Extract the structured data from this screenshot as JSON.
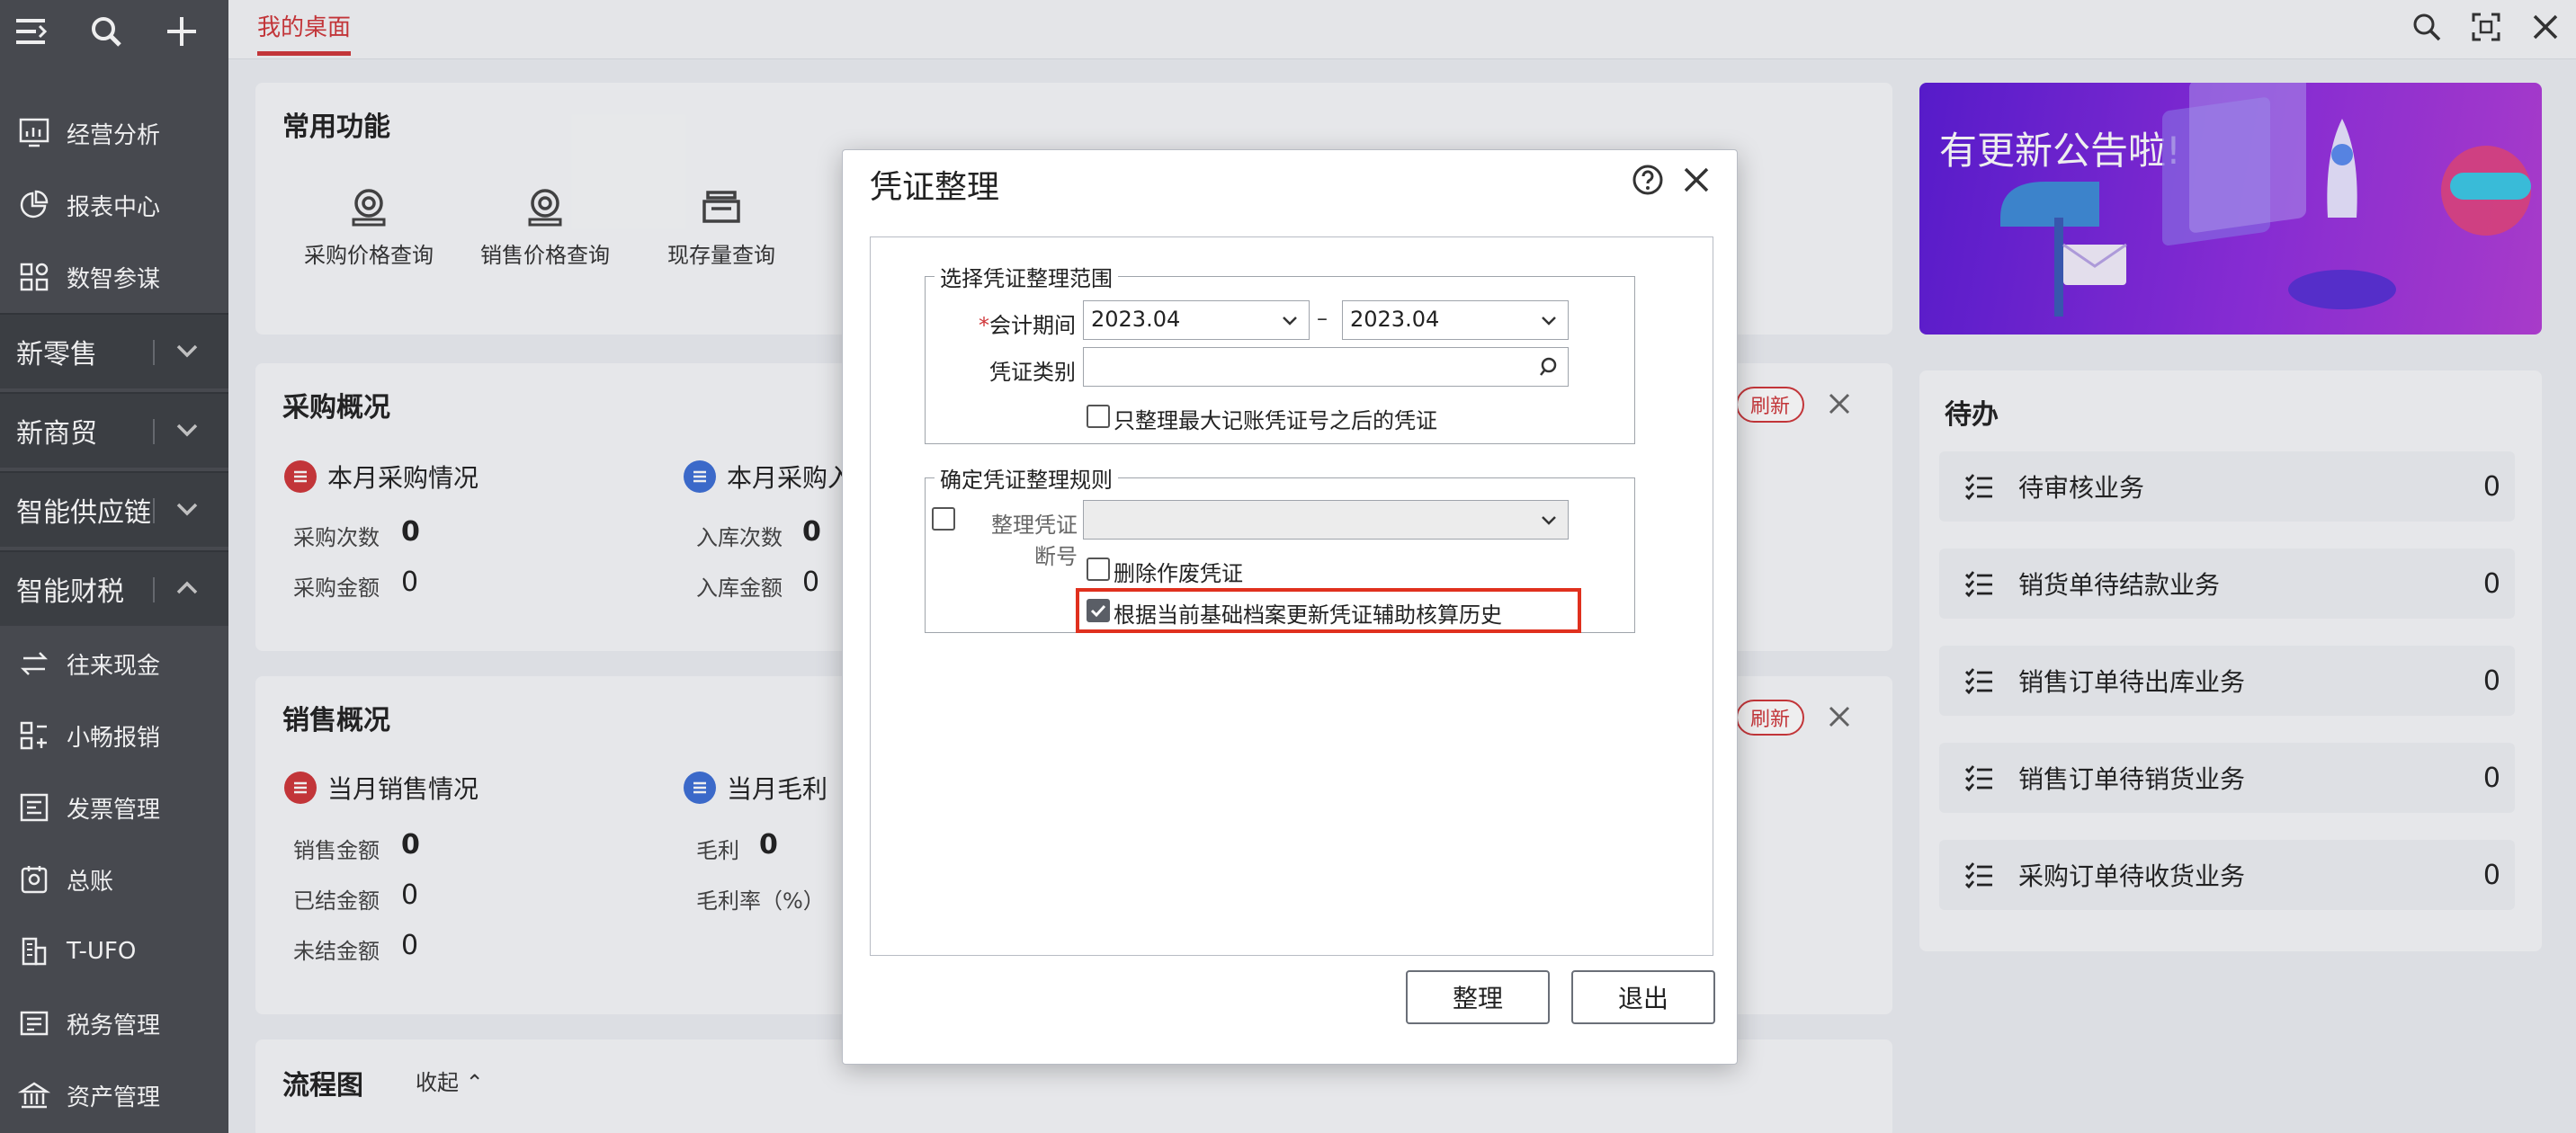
{
  "sidebar": {
    "items": [
      {
        "label": "经营分析",
        "icon": "bar-chart-icon"
      },
      {
        "label": "报表中心",
        "icon": "pie-chart-icon"
      },
      {
        "label": "数智参谋",
        "icon": "grid-icon"
      },
      {
        "label": "往来现金",
        "icon": "transfer-icon"
      },
      {
        "label": "小畅报销",
        "icon": "reimburse-icon"
      },
      {
        "label": "发票管理",
        "icon": "invoice-icon"
      },
      {
        "label": "总账",
        "icon": "ledger-icon"
      },
      {
        "label": "T-UFO",
        "icon": "building-icon"
      },
      {
        "label": "税务管理",
        "icon": "tax-icon"
      },
      {
        "label": "资产管理",
        "icon": "bank-icon"
      }
    ],
    "groups": [
      {
        "label": "新零售"
      },
      {
        "label": "新商贸"
      },
      {
        "label": "智能供应链"
      },
      {
        "label": "智能财税"
      }
    ]
  },
  "topnav": {
    "home_tab": "我的桌面"
  },
  "common": {
    "title": "常用功能",
    "items": [
      {
        "label": "采购价格查询"
      },
      {
        "label": "销售价格查询"
      },
      {
        "label": "现存量查询"
      }
    ]
  },
  "purchase": {
    "title": "采购概况",
    "refresh": "刷新",
    "left_head": "本月采购情况",
    "right_head": "本月采购入",
    "rows_left": [
      {
        "label": "采购次数",
        "value": "0"
      },
      {
        "label": "采购金额",
        "value": "0"
      }
    ],
    "rows_right": [
      {
        "label": "入库次数",
        "value": "0"
      },
      {
        "label": "入库金额",
        "value": "0"
      }
    ]
  },
  "sales": {
    "title": "销售概况",
    "refresh": "刷新",
    "left_head": "当月销售情况",
    "right_head": "当月毛利",
    "rows_left": [
      {
        "label": "销售金额",
        "value": "0"
      },
      {
        "label": "已结金额",
        "value": "0"
      },
      {
        "label": "未结金额",
        "value": "0"
      }
    ],
    "rows_right": [
      {
        "label": "毛利",
        "value": "0"
      },
      {
        "label": "毛利率（%）",
        "value": ""
      }
    ]
  },
  "flow": {
    "title": "流程图",
    "collapse": "收起"
  },
  "banner": {
    "text": "有更新公告啦!"
  },
  "todo": {
    "title": "待办",
    "items": [
      {
        "label": "待审核业务",
        "count": "0"
      },
      {
        "label": "销货单待结款业务",
        "count": "0"
      },
      {
        "label": "销售订单待出库业务",
        "count": "0"
      },
      {
        "label": "销售订单待销货业务",
        "count": "0"
      },
      {
        "label": "采购订单待收货业务",
        "count": "0"
      }
    ]
  },
  "dialog": {
    "title": "凭证整理",
    "range_legend": "选择凭证整理范围",
    "period_label": "会计期间",
    "period_from": "2023.04",
    "period_sep": "–",
    "period_to": "2023.04",
    "category_label": "凭证类别",
    "only_after_max": "只整理最大记账凭证号之后的凭证",
    "rule_legend": "确定凭证整理规则",
    "break_label": "整理凭证断号",
    "delete_void": "删除作废凭证",
    "update_history": "根据当前基础档案更新凭证辅助核算历史",
    "update_history_checked": true,
    "ok": "整理",
    "exit": "退出"
  },
  "colors": {
    "accent": "#d0373a",
    "sidebar": "#4a4d52",
    "highlight": "#e0301e"
  }
}
